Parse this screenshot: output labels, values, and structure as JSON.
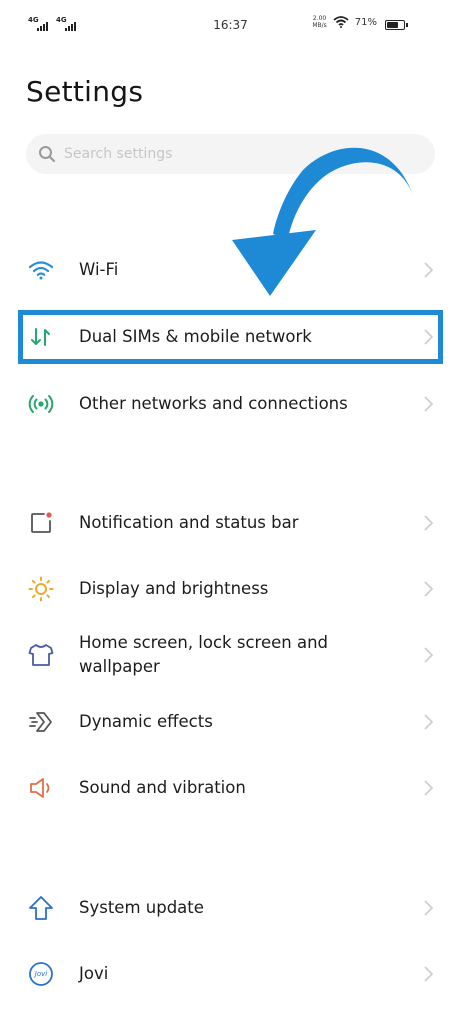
{
  "status_bar": {
    "network_1": "4G",
    "network_2": "4G",
    "time": "16:37",
    "speed_value": "2.00",
    "speed_unit": "MB/s",
    "battery_percent": "71%",
    "battery_level": 0.71
  },
  "header": {
    "title": "Settings"
  },
  "search": {
    "placeholder": "Search settings",
    "value": ""
  },
  "settings": {
    "wifi": {
      "label": "Wi-Fi",
      "icon": "wifi-icon"
    },
    "dual_sim": {
      "label": "Dual SIMs & mobile network",
      "icon": "mobile-data-icon"
    },
    "other_networks": {
      "label": "Other networks and connections",
      "icon": "connections-icon"
    },
    "notification": {
      "label": "Notification and status bar",
      "icon": "notification-icon"
    },
    "display": {
      "label": "Display and brightness",
      "icon": "brightness-icon"
    },
    "home_screen": {
      "label": "Home screen, lock screen and wallpaper",
      "icon": "wallpaper-icon"
    },
    "dynamic_effects": {
      "label": "Dynamic effects",
      "icon": "dynamic-effects-icon"
    },
    "sound": {
      "label": "Sound and vibration",
      "icon": "speaker-icon"
    },
    "system_update": {
      "label": "System update",
      "icon": "update-arrow-icon"
    },
    "jovi": {
      "label": "Jovi",
      "icon": "jovi-icon",
      "icon_text": "Jovi"
    }
  },
  "annotation": {
    "highlight_color": "#1e8ad6",
    "arrow_color": "#1e8ad6"
  }
}
